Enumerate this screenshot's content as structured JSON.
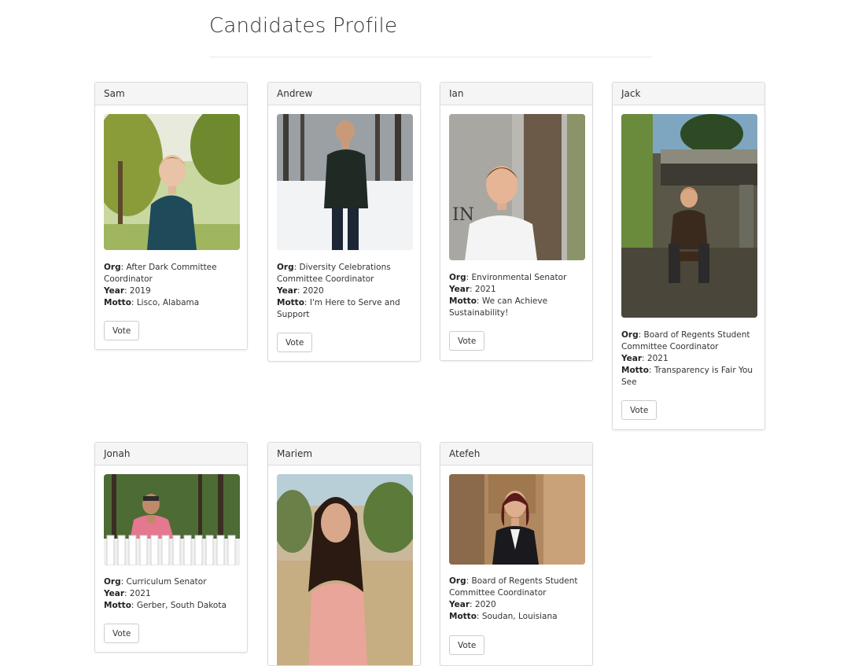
{
  "page": {
    "title": "Candidates Profile"
  },
  "labels": {
    "org": "Org",
    "year": "Year",
    "motto": "Motto"
  },
  "candidates": [
    {
      "name": "Sam",
      "org": "After Dark Committee Coordinator",
      "year": "2019",
      "motto": "Lisco, Alabama",
      "vote_label": "Vote"
    },
    {
      "name": "Andrew",
      "org": "Diversity Celebrations Committee Coordinator",
      "year": "2020",
      "motto": "I'm Here to Serve and Support",
      "vote_label": "Vote"
    },
    {
      "name": "Ian",
      "org": "Environmental Senator",
      "year": "2021",
      "motto": "We can Achieve Sustainability!",
      "vote_label": "Vote"
    },
    {
      "name": "Jack",
      "org": "Board of Regents Student Committee Coordinator",
      "year": "2021",
      "motto": "Transparency is Fair You See",
      "vote_label": "Vote"
    },
    {
      "name": "Jonah",
      "org": "Curriculum Senator",
      "year": "2021",
      "motto": "Gerber, South Dakota",
      "vote_label": "Vote"
    },
    {
      "name": "Mariem",
      "org": "",
      "year": "",
      "motto": "",
      "vote_label": ""
    },
    {
      "name": "Atefeh",
      "org": "Board of Regents Student Committee Coordinator",
      "year": "2020",
      "motto": "Soudan, Louisiana",
      "vote_label": "Vote"
    }
  ]
}
